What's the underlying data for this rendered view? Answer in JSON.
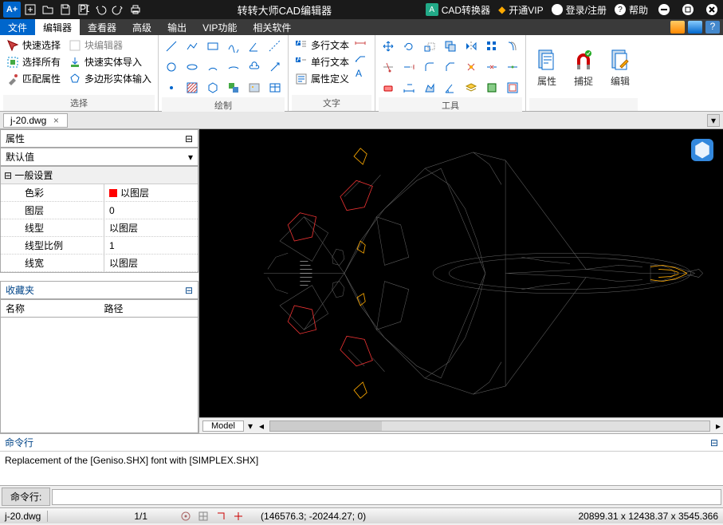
{
  "titlebar": {
    "appTitle": "转转大师CAD编辑器",
    "converter": "CAD转换器",
    "vip": "开通VIP",
    "login": "登录/注册",
    "help": "帮助"
  },
  "menubar": {
    "file": "文件",
    "tabs": [
      "编辑器",
      "查看器",
      "高级",
      "输出",
      "VIP功能",
      "相关软件"
    ]
  },
  "ribbon": {
    "select": {
      "quickSelect": "快速选择",
      "selectAll": "选择所有",
      "matchProps": "匹配属性",
      "blockEditor": "块编辑器",
      "quickEntityImport": "快速实体导入",
      "polyEntityInput": "多边形实体输入",
      "label": "选择"
    },
    "draw": {
      "label": "绘制"
    },
    "text": {
      "multiText": "多行文本",
      "singleText": "单行文本",
      "propDef": "属性定义",
      "label": "文字"
    },
    "tools": {
      "label": "工具"
    },
    "props": "属性",
    "snap": "捕捉",
    "edit": "编辑"
  },
  "fileTab": {
    "name": "j-20.dwg"
  },
  "propsPanel": {
    "title": "属性",
    "default": "默认值",
    "section": "一般设置",
    "rows": {
      "color": {
        "k": "色彩",
        "v": "以图层"
      },
      "layer": {
        "k": "图层",
        "v": "0"
      },
      "linetype": {
        "k": "线型",
        "v": "以图层"
      },
      "linescale": {
        "k": "线型比例",
        "v": "1"
      },
      "lineweight": {
        "k": "线宽",
        "v": "以图层"
      }
    },
    "fav": "收藏夹",
    "favCols": {
      "name": "名称",
      "path": "路径"
    }
  },
  "modelTab": "Model",
  "cmd": {
    "title": "命令行",
    "log": "Replacement of the [Geniso.SHX] font with [SIMPLEX.SHX]",
    "prompt": "命令行:"
  },
  "status": {
    "file": "j-20.dwg",
    "page": "1/1",
    "coords": "(146576.3; -20244.27; 0)",
    "dims": "20899.31 x 12438.37 x 3545.366"
  }
}
